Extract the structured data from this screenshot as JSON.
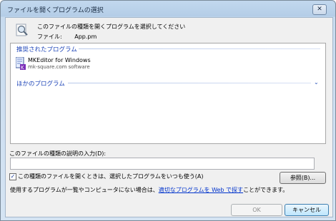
{
  "window": {
    "title": "ファイルを開くプログラムの選択",
    "close_glyph": "✕"
  },
  "header": {
    "description": "このファイルの種類を開くプログラムを選択してください",
    "file_label": "ファイル:",
    "file_name": "App.pm"
  },
  "program_list": {
    "recommended_header": "推奨されたプログラム",
    "other_header": "ほかのプログラム",
    "other_chevron": "⌄",
    "items": [
      {
        "name": "MKEditor for Windows",
        "publisher": "mk-square.com software",
        "icon": "mkeditor-icon"
      }
    ]
  },
  "description_field": {
    "label": "このファイルの種類の説明の入力(D):",
    "value": ""
  },
  "always_use": {
    "label": "この種類のファイルを開くときは、選択したプログラムをいつも使う(A)",
    "checked": true,
    "check_glyph": "✓"
  },
  "browse_button": "参照(B)...",
  "info": {
    "text_before": "使用するプログラムが一覧やコンピュータにない場合は、",
    "link_text": "適切なプログラムを Web で探す",
    "text_after": "ことができます。"
  },
  "buttons": {
    "ok": "OK",
    "cancel": "キャンセル"
  },
  "colors": {
    "group_header": "#1e45b8",
    "link": "#0033cc"
  }
}
